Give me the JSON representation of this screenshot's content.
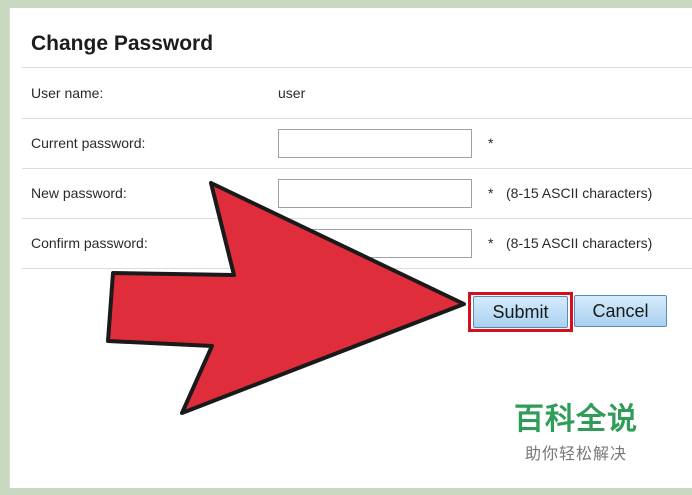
{
  "form": {
    "title": "Change Password",
    "username_label": "User name:",
    "username_value": "user",
    "current_label": "Current password:",
    "current_required": "*",
    "new_label": "New password:",
    "new_required": "*",
    "new_hint": "(8-15 ASCII characters)",
    "confirm_label": "Confirm password:",
    "confirm_required": "*",
    "confirm_hint": "(8-15 ASCII characters)",
    "current_value": "",
    "new_value": "",
    "confirm_value": ""
  },
  "buttons": {
    "submit_label": "Submit",
    "cancel_label": "Cancel"
  },
  "overlay": {
    "arrow_color": "#e02d3c",
    "highlight_color": "#d4101c"
  },
  "watermark": {
    "main": "百科全说",
    "sub": "助你轻松解决"
  }
}
